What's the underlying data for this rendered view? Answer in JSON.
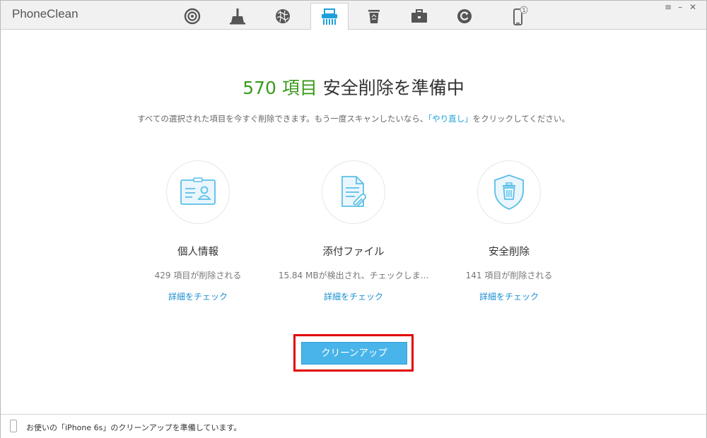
{
  "app": {
    "title": "PhoneClean"
  },
  "toolbar": {
    "tabs": [
      {
        "icon": "privacy-icon"
      },
      {
        "icon": "broom-icon"
      },
      {
        "icon": "internet-icon"
      },
      {
        "icon": "shredder-icon",
        "active": true
      },
      {
        "icon": "trash-icon"
      },
      {
        "icon": "toolbox-icon"
      },
      {
        "icon": "history-icon"
      },
      {
        "icon": "device-icon",
        "badge": "1"
      }
    ]
  },
  "window_controls": {
    "menu": "≡",
    "minimize": "–",
    "close": "✕"
  },
  "main": {
    "headline_count": "570 項目",
    "headline_text": " 安全削除を準備中",
    "subtitle_before": "すべての選択された項目を今すぐ削除できます。もう一度スキャンしたいなら、",
    "subtitle_link": "「やり直し」",
    "subtitle_after": "をクリックしてください。"
  },
  "cards": [
    {
      "icon": "contact-card-icon",
      "title": "個人情報",
      "desc": "429 項目が削除される",
      "link": "詳細をチェック"
    },
    {
      "icon": "attachment-file-icon",
      "title": "添付ファイル",
      "desc": "15.84 MBが検出され、チェックしま...",
      "link": "詳細をチェック"
    },
    {
      "icon": "secure-delete-shield-icon",
      "title": "安全削除",
      "desc": "141 項目が削除される",
      "link": "詳細をチェック"
    }
  ],
  "actions": {
    "cleanup_label": "クリーンアップ"
  },
  "status": {
    "message": "お使いの「iPhone 6s」のクリーンアップを準備しています。"
  },
  "colors": {
    "accent": "#48b4ea",
    "count_green": "#3a9a1a",
    "highlight_red": "#e10000",
    "link": "#1a8fd0",
    "icon_blue": "#5bbfe8"
  }
}
